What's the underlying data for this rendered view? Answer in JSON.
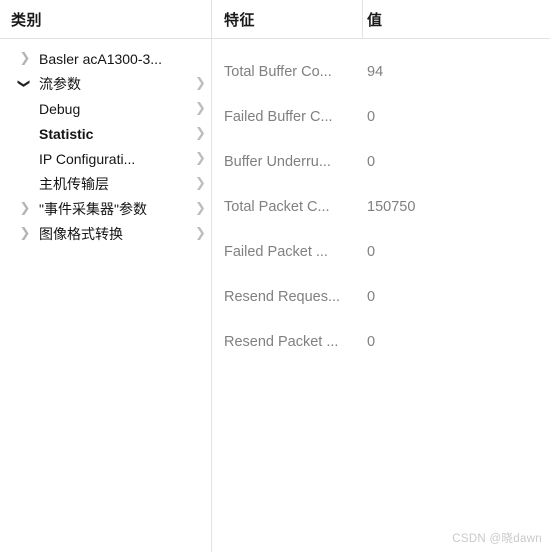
{
  "headers": {
    "category": "类别",
    "feature": "特征",
    "value": "值"
  },
  "tree": {
    "items": [
      {
        "label": "Basler acA1300-3...",
        "expander": "collapsed",
        "expander_glyph": "❯",
        "submenu_glyph": "",
        "has_submenu": false,
        "bold": false
      },
      {
        "label": "流参数",
        "expander": "expanded",
        "expander_glyph": "❯",
        "submenu_glyph": "❯",
        "has_submenu": true,
        "bold": false
      },
      {
        "label": "Debug",
        "expander": "none",
        "expander_glyph": "",
        "submenu_glyph": "❯",
        "has_submenu": true,
        "bold": false
      },
      {
        "label": "Statistic",
        "expander": "none",
        "expander_glyph": "",
        "submenu_glyph": "❯",
        "has_submenu": true,
        "bold": true
      },
      {
        "label": "IP Configurati...",
        "expander": "none",
        "expander_glyph": "",
        "submenu_glyph": "❯",
        "has_submenu": true,
        "bold": false
      },
      {
        "label": "主机传输层",
        "expander": "none",
        "expander_glyph": "",
        "submenu_glyph": "❯",
        "has_submenu": true,
        "bold": false
      },
      {
        "label": "\"事件采集器\"参数",
        "expander": "collapsed",
        "expander_glyph": "❯",
        "submenu_glyph": "❯",
        "has_submenu": true,
        "bold": false
      },
      {
        "label": "图像格式转换",
        "expander": "collapsed",
        "expander_glyph": "❯",
        "submenu_glyph": "❯",
        "has_submenu": true,
        "bold": false
      }
    ]
  },
  "table": {
    "rows": [
      {
        "feature": "Total Buffer Co...",
        "value": "94"
      },
      {
        "feature": "Failed Buffer C...",
        "value": "0"
      },
      {
        "feature": "Buffer Underru...",
        "value": "0"
      },
      {
        "feature": "Total Packet C...",
        "value": "150750"
      },
      {
        "feature": "Failed Packet ...",
        "value": "0"
      },
      {
        "feature": "Resend Reques...",
        "value": "0"
      },
      {
        "feature": "Resend Packet ...",
        "value": "0"
      }
    ]
  },
  "watermark": {
    "text": "CSDN @晓dawn"
  },
  "colors": {
    "text_primary": "#141414",
    "text_muted": "#808080",
    "chevron": "#b4b4b4",
    "divider": "#e2e2e2",
    "watermark": "#c9c9c9"
  }
}
